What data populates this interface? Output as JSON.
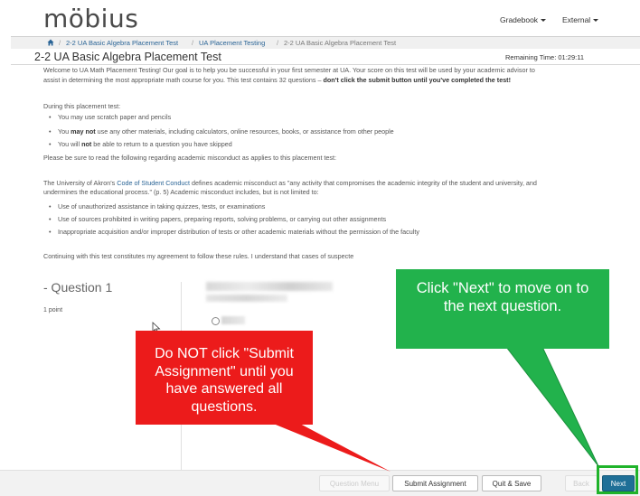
{
  "header": {
    "logo": "möbius",
    "nav": [
      {
        "label": "Gradebook"
      },
      {
        "label": "External"
      }
    ]
  },
  "breadcrumb": {
    "home_icon": "home-icon",
    "items": [
      "2-2 UA Basic Algebra Placement Test",
      "UA Placement Testing",
      "2-2 UA Basic Algebra Placement Test"
    ],
    "separator": "/"
  },
  "test": {
    "title": "2-2 UA Basic Algebra Placement Test",
    "remaining_label": "Remaining Time:",
    "remaining_value": "01:29:11"
  },
  "instructions": {
    "intro_1": "Welcome to UA Math Placement Testing! Our goal is to help you be successful in your first semester at UA. Your score on this test will be used by your academic advisor to",
    "intro_2a": "assist in determining the most appropriate math course for you.  This test contains 32 questions – ",
    "intro_2b": "don't click the submit button until you've completed the test!",
    "during_label": "During this placement test:",
    "rules": [
      {
        "pre": "You may use scratch paper and pencils",
        "bold": "",
        "post": ""
      },
      {
        "pre": "You ",
        "bold": "may not",
        "post": " use any other materials, including calculators, online resources, books, or assistance from other people"
      },
      {
        "pre": "You will ",
        "bold": "not",
        "post": " be able to return to a question you have skipped"
      }
    ],
    "read_note": "Please be sure to read the following regarding academic misconduct as applies to this placement test:",
    "akron_1a": "The University of Akron's ",
    "akron_link": "Code of Student Conduct",
    "akron_1b": " defines academic misconduct as \"any activity that compromises the academic integrity of the student and university, and",
    "akron_2": "undermines the educational process.\" (p. 5) Academic misconduct includes, but is not limited to:",
    "misconduct": [
      "Use of unauthorized assistance in taking quizzes, tests, or examinations",
      "Use of sources prohibited in writing papers, preparing reports, solving problems, or carrying out other assignments",
      "Inappropriate acquisition and/or improper distribution of tests or other academic materials without the permission of the faculty"
    ],
    "agreement": "Continuing with this test constitutes my agreement to follow these rules. I understand that cases of suspecte"
  },
  "question": {
    "title": "- Question 1",
    "points": "1 point"
  },
  "buttons": {
    "question_menu": "Question Menu",
    "submit": "Submit Assignment",
    "quit_save": "Quit & Save",
    "back": "Back",
    "next": "Next"
  },
  "callouts": {
    "green": [
      "Click \"Next\" to move on to",
      "the next question."
    ],
    "red": [
      "Do NOT click \"Submit",
      "Assignment\" until you",
      "have answered all",
      "questions."
    ],
    "green_color": "#22b24c",
    "red_color": "#ec1b1b"
  }
}
